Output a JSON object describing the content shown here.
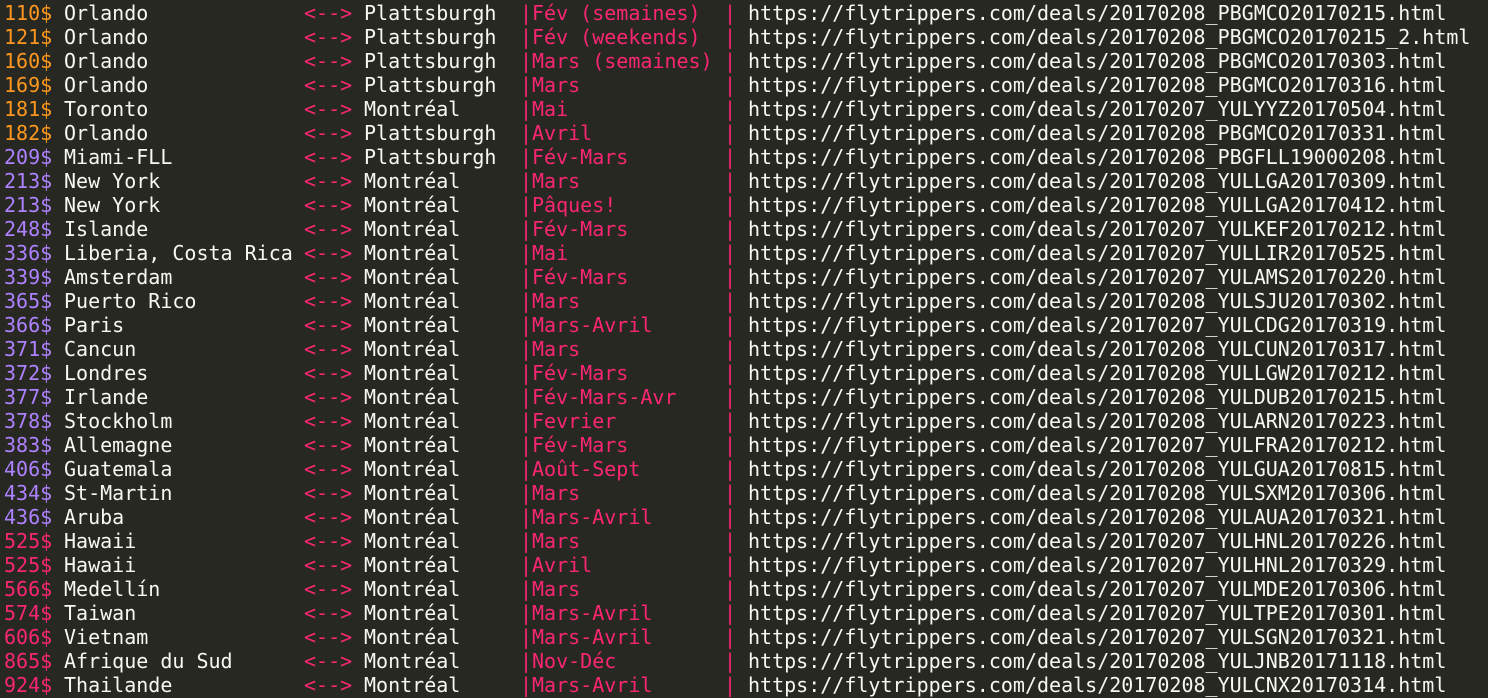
{
  "colors": {
    "background": "#272822",
    "text": "#f8f8f2",
    "accent": "#f92672",
    "price_low": "#fd971f",
    "price_mid": "#ae81ff",
    "price_high": "#f92672"
  },
  "separator": "|",
  "arrow": "<-->",
  "rows": [
    {
      "price": "110$",
      "city": "Orlando",
      "origin": "Plattsburgh",
      "period": "Fév (semaines)",
      "url": "https://flytrippers.com/deals/20170208_PBGMCO20170215.html",
      "tier": "low"
    },
    {
      "price": "121$",
      "city": "Orlando",
      "origin": "Plattsburgh",
      "period": "Fév (weekends)",
      "url": "https://flytrippers.com/deals/20170208_PBGMCO20170215_2.html",
      "tier": "low"
    },
    {
      "price": "160$",
      "city": "Orlando",
      "origin": "Plattsburgh",
      "period": "Mars (semaines)",
      "url": "https://flytrippers.com/deals/20170208_PBGMCO20170303.html",
      "tier": "low"
    },
    {
      "price": "169$",
      "city": "Orlando",
      "origin": "Plattsburgh",
      "period": "Mars",
      "url": "https://flytrippers.com/deals/20170208_PBGMCO20170316.html",
      "tier": "low"
    },
    {
      "price": "181$",
      "city": "Toronto",
      "origin": "Montréal",
      "period": "Mai",
      "url": "https://flytrippers.com/deals/20170207_YULYYZ20170504.html",
      "tier": "low"
    },
    {
      "price": "182$",
      "city": "Orlando",
      "origin": "Plattsburgh",
      "period": "Avril",
      "url": "https://flytrippers.com/deals/20170208_PBGMCO20170331.html",
      "tier": "low"
    },
    {
      "price": "209$",
      "city": "Miami-FLL",
      "origin": "Plattsburgh",
      "period": "Fév-Mars",
      "url": "https://flytrippers.com/deals/20170208_PBGFLL19000208.html",
      "tier": "mid"
    },
    {
      "price": "213$",
      "city": "New York",
      "origin": "Montréal",
      "period": "Mars",
      "url": "https://flytrippers.com/deals/20170208_YULLGA20170309.html",
      "tier": "mid"
    },
    {
      "price": "213$",
      "city": "New York",
      "origin": "Montréal",
      "period": "Pâques!",
      "url": "https://flytrippers.com/deals/20170208_YULLGA20170412.html",
      "tier": "mid"
    },
    {
      "price": "248$",
      "city": "Islande",
      "origin": "Montréal",
      "period": "Fév-Mars",
      "url": "https://flytrippers.com/deals/20170207_YULKEF20170212.html",
      "tier": "mid"
    },
    {
      "price": "336$",
      "city": "Liberia, Costa Rica",
      "origin": "Montréal",
      "period": "Mai",
      "url": "https://flytrippers.com/deals/20170207_YULLIR20170525.html",
      "tier": "mid"
    },
    {
      "price": "339$",
      "city": "Amsterdam",
      "origin": "Montréal",
      "period": "Fév-Mars",
      "url": "https://flytrippers.com/deals/20170207_YULAMS20170220.html",
      "tier": "mid"
    },
    {
      "price": "365$",
      "city": "Puerto Rico",
      "origin": "Montréal",
      "period": "Mars",
      "url": "https://flytrippers.com/deals/20170208_YULSJU20170302.html",
      "tier": "mid"
    },
    {
      "price": "366$",
      "city": "Paris",
      "origin": "Montréal",
      "period": "Mars-Avril",
      "url": "https://flytrippers.com/deals/20170207_YULCDG20170319.html",
      "tier": "mid"
    },
    {
      "price": "371$",
      "city": "Cancun",
      "origin": "Montréal",
      "period": "Mars",
      "url": "https://flytrippers.com/deals/20170208_YULCUN20170317.html",
      "tier": "mid"
    },
    {
      "price": "372$",
      "city": "Londres",
      "origin": "Montréal",
      "period": "Fév-Mars",
      "url": "https://flytrippers.com/deals/20170208_YULLGW20170212.html",
      "tier": "mid"
    },
    {
      "price": "377$",
      "city": "Irlande",
      "origin": "Montréal",
      "period": "Fév-Mars-Avr",
      "url": "https://flytrippers.com/deals/20170208_YULDUB20170215.html",
      "tier": "mid"
    },
    {
      "price": "378$",
      "city": "Stockholm",
      "origin": "Montréal",
      "period": "Fevrier",
      "url": "https://flytrippers.com/deals/20170208_YULARN20170223.html",
      "tier": "mid"
    },
    {
      "price": "383$",
      "city": "Allemagne",
      "origin": "Montréal",
      "period": "Fév-Mars",
      "url": "https://flytrippers.com/deals/20170207_YULFRA20170212.html",
      "tier": "mid"
    },
    {
      "price": "406$",
      "city": "Guatemala",
      "origin": "Montréal",
      "period": "Août-Sept",
      "url": "https://flytrippers.com/deals/20170208_YULGUA20170815.html",
      "tier": "mid"
    },
    {
      "price": "434$",
      "city": "St-Martin",
      "origin": "Montréal",
      "period": "Mars",
      "url": "https://flytrippers.com/deals/20170208_YULSXM20170306.html",
      "tier": "mid"
    },
    {
      "price": "436$",
      "city": "Aruba",
      "origin": "Montréal",
      "period": "Mars-Avril",
      "url": "https://flytrippers.com/deals/20170208_YULAUA20170321.html",
      "tier": "mid"
    },
    {
      "price": "525$",
      "city": "Hawaii",
      "origin": "Montréal",
      "period": "Mars",
      "url": "https://flytrippers.com/deals/20170207_YULHNL20170226.html",
      "tier": "high"
    },
    {
      "price": "525$",
      "city": "Hawaii",
      "origin": "Montréal",
      "period": "Avril",
      "url": "https://flytrippers.com/deals/20170207_YULHNL20170329.html",
      "tier": "high"
    },
    {
      "price": "566$",
      "city": "Medellín",
      "origin": "Montréal",
      "period": "Mars",
      "url": "https://flytrippers.com/deals/20170207_YULMDE20170306.html",
      "tier": "high"
    },
    {
      "price": "574$",
      "city": "Taiwan",
      "origin": "Montréal",
      "period": "Mars-Avril",
      "url": "https://flytrippers.com/deals/20170207_YULTPE20170301.html",
      "tier": "high"
    },
    {
      "price": "606$",
      "city": "Vietnam",
      "origin": "Montréal",
      "period": "Mars-Avril",
      "url": "https://flytrippers.com/deals/20170207_YULSGN20170321.html",
      "tier": "high"
    },
    {
      "price": "865$",
      "city": "Afrique du Sud",
      "origin": "Montréal",
      "period": "Nov-Déc",
      "url": "https://flytrippers.com/deals/20170208_YULJNB20171118.html",
      "tier": "high"
    },
    {
      "price": "924$",
      "city": "Thailande",
      "origin": "Montréal",
      "period": "Mars-Avril",
      "url": "https://flytrippers.com/deals/20170208_YULCNX20170314.html",
      "tier": "high"
    }
  ]
}
